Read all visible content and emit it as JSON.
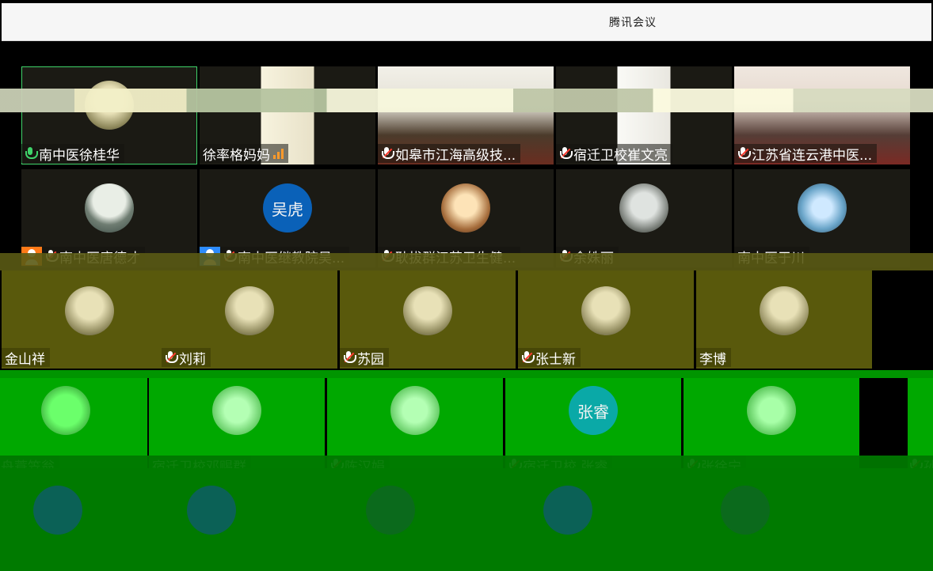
{
  "window": {
    "title": "腾讯会议"
  },
  "participants": {
    "row1": [
      {
        "name": "南中医徐桂华",
        "mic": "on",
        "active": true
      },
      {
        "name": "徐率格妈妈",
        "mic": "none",
        "signal": true
      },
      {
        "name": "如皋市江海高级技...",
        "mic": "muted"
      },
      {
        "name": "宿迁卫校崔文亮",
        "mic": "muted"
      },
      {
        "name": "江苏省连云港中医...",
        "mic": "muted"
      }
    ],
    "row2": [
      {
        "name": "南中医唐德才",
        "mic": "muted",
        "badge": "orange"
      },
      {
        "name": "南中医继教院吴...",
        "mic": "muted",
        "badge": "blue",
        "avatar_text": "吴虎"
      },
      {
        "name": "耿拔群江苏卫生健...",
        "mic": "muted"
      },
      {
        "name": "余姝丽",
        "mic": "muted"
      },
      {
        "name": "南中医于川",
        "mic": "none"
      }
    ],
    "row3": [
      {
        "name": "金山祥",
        "mic": "none"
      },
      {
        "name": "刘莉",
        "mic": "muted"
      },
      {
        "name": "苏园",
        "mic": "muted"
      },
      {
        "name": "张士新",
        "mic": "muted"
      },
      {
        "name": "李博",
        "mic": "none"
      }
    ],
    "row4": [
      {
        "name": "孤舟蓑笠翁",
        "mic": "none"
      },
      {
        "name": "宿迁卫校邓赐群",
        "mic": "none"
      },
      {
        "name": "陈汉娟",
        "mic": "muted"
      },
      {
        "name": "宿迁卫校 张睿",
        "mic": "muted",
        "avatar_text": "张睿"
      },
      {
        "name": "张徐宁",
        "mic": "muted"
      },
      {
        "name": "孙",
        "mic": "muted"
      }
    ]
  },
  "colors": {
    "active_border": "#3fd36a",
    "muted_slash": "#ff3b2f",
    "signal": "#ff9a2a",
    "avatar_blue": "#0a61b8",
    "avatar_teal": "#0aa9a7"
  }
}
